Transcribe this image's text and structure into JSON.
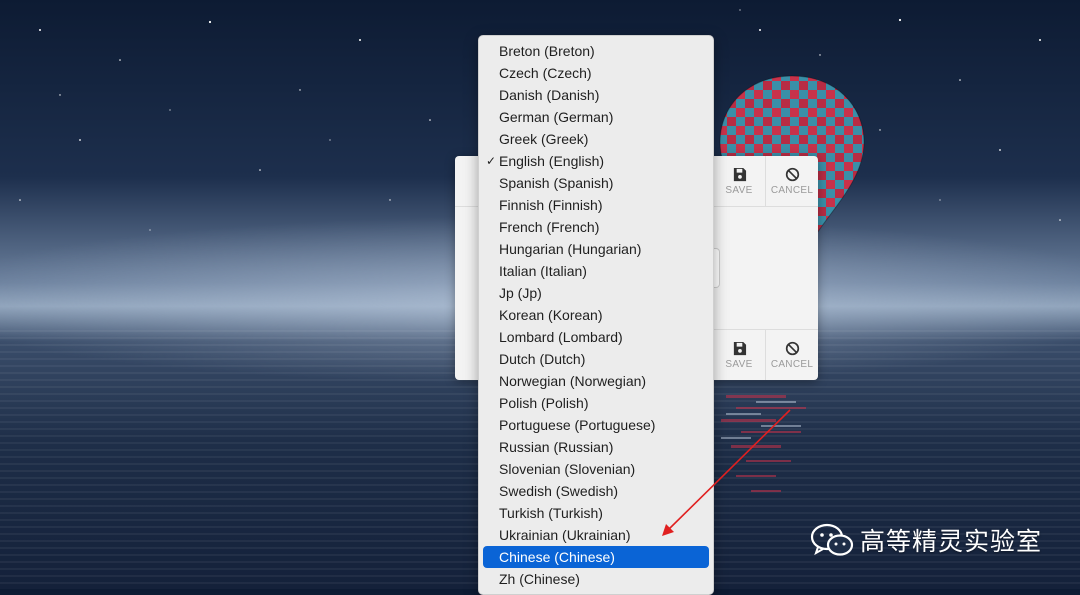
{
  "dialog": {
    "toolbar_top": {
      "save_label": "SAVE",
      "cancel_label": "CANCEL"
    },
    "toolbar_bottom": {
      "save_label": "SAVE",
      "cancel_label": "CANCEL"
    }
  },
  "language_menu": {
    "items": [
      {
        "label": "Breton (Breton)"
      },
      {
        "label": "Czech (Czech)"
      },
      {
        "label": "Danish (Danish)"
      },
      {
        "label": "German (German)"
      },
      {
        "label": "Greek (Greek)"
      },
      {
        "label": "English (English)",
        "checked": true
      },
      {
        "label": "Spanish (Spanish)"
      },
      {
        "label": "Finnish (Finnish)"
      },
      {
        "label": "French (French)"
      },
      {
        "label": "Hungarian (Hungarian)"
      },
      {
        "label": "Italian (Italian)"
      },
      {
        "label": "Jp (Jp)"
      },
      {
        "label": "Korean (Korean)"
      },
      {
        "label": "Lombard (Lombard)"
      },
      {
        "label": "Dutch (Dutch)"
      },
      {
        "label": "Norwegian (Norwegian)"
      },
      {
        "label": "Polish (Polish)"
      },
      {
        "label": "Portuguese (Portuguese)"
      },
      {
        "label": "Russian (Russian)"
      },
      {
        "label": "Slovenian (Slovenian)"
      },
      {
        "label": "Swedish (Swedish)"
      },
      {
        "label": "Turkish (Turkish)"
      },
      {
        "label": "Ukrainian (Ukrainian)"
      },
      {
        "label": "Chinese (Chinese)",
        "highlighted": true
      },
      {
        "label": "Zh (Chinese)"
      }
    ],
    "check_glyph": "✓"
  },
  "watermark": {
    "text": "高等精灵实验室",
    "icon": "wechat-icon"
  },
  "colors": {
    "highlight": "#0a64d6",
    "annotation_arrow": "#e02020",
    "menu_bg": "#ececec"
  }
}
